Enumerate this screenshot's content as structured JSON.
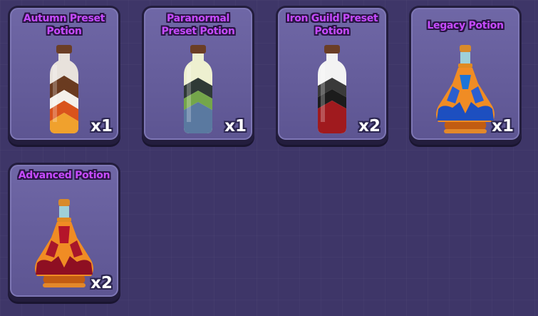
{
  "inventory": {
    "items": [
      {
        "name": "Autumn Preset Potion",
        "quantity": "x1",
        "icon": "autumn-potion-icon"
      },
      {
        "name": "Paranormal Preset Potion",
        "quantity": "x1",
        "icon": "paranormal-potion-icon"
      },
      {
        "name": "Iron Guild Preset Potion",
        "quantity": "x2",
        "icon": "iron-guild-potion-icon"
      },
      {
        "name": "Legacy Potion",
        "quantity": "x1",
        "icon": "legacy-potion-icon"
      },
      {
        "name": "Advanced Potion",
        "quantity": "x2",
        "icon": "advanced-potion-icon"
      }
    ]
  },
  "colors": {
    "background": "#3e3668",
    "slot_fill": "#6a62a2",
    "slot_border": "#231d3d",
    "title_text": "#c64bff",
    "quantity_text": "#ffffff"
  }
}
